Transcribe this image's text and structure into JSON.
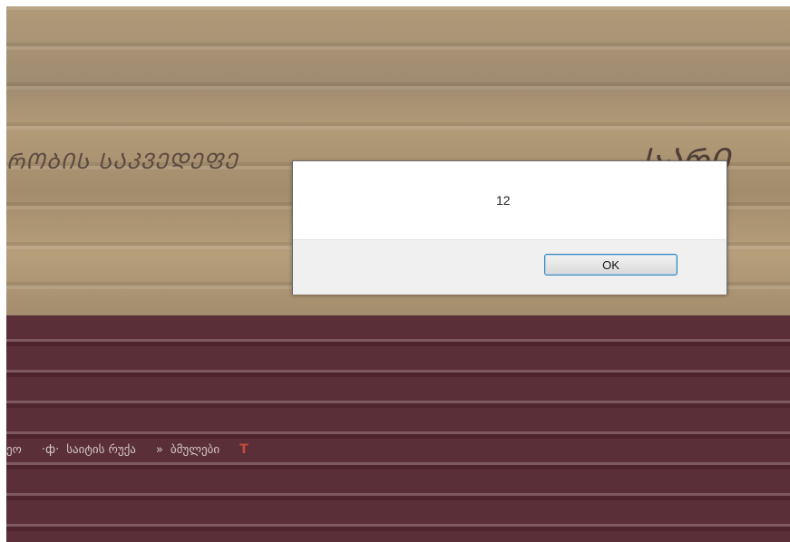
{
  "banner": {
    "title": "ᲠᲝᲑᲘᲡ ᲡᲐᲙᲕᲔᲓᲔᲤᲔ",
    "logo": "ᲡᲐᲠᲘ"
  },
  "nav": {
    "items": [
      {
        "label": "ეო",
        "icon": ""
      },
      {
        "label": "საიტის რუქა",
        "icon": "sitemap-icon",
        "glyph": "·ф·"
      },
      {
        "label": "ბმულები",
        "icon": "double-chevron-icon",
        "glyph": "»"
      }
    ],
    "tool_icon": "tool-icon",
    "tool_glyph": "T"
  },
  "dialog": {
    "message": "12",
    "ok_label": "OK"
  },
  "colors": {
    "banner": "#b09a79",
    "nav_background": "#5a2f38",
    "dialog_footer": "#f0f0f0",
    "button_border": "#3c7fb1"
  }
}
